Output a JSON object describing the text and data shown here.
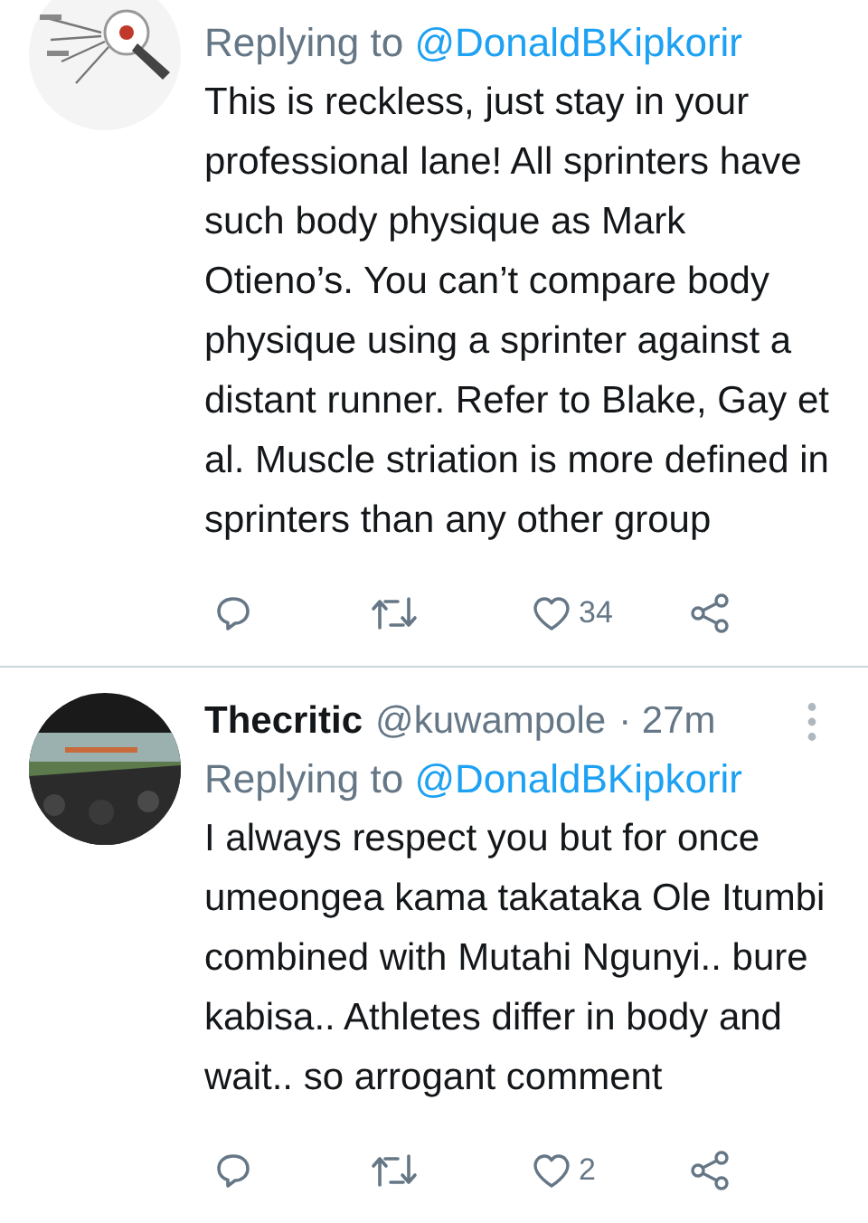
{
  "tweets": [
    {
      "replying_label": "Replying to",
      "replying_to": "@DonaldBKipkorir",
      "text": "This is reckless, just stay in your professional lane! All sprinters have such body physique as Mark Otieno’s. You can’t compare body physique using a sprinter against a distant runner. Refer to Blake, Gay et al. Muscle striation is more defined in sprinters than any other group",
      "likes": "34"
    },
    {
      "author": "Thecritic",
      "handle": "@kuwampole",
      "time": "· 27m",
      "replying_label": "Replying to",
      "replying_to": "@DonaldBKipkorir",
      "text": "I always respect you but for once umeongea kama takataka Ole Itumbi combined with Mutahi Ngunyi.. bure kabisa.. Athletes differ in body and wait.. so arrogant comment",
      "likes": "2"
    }
  ]
}
